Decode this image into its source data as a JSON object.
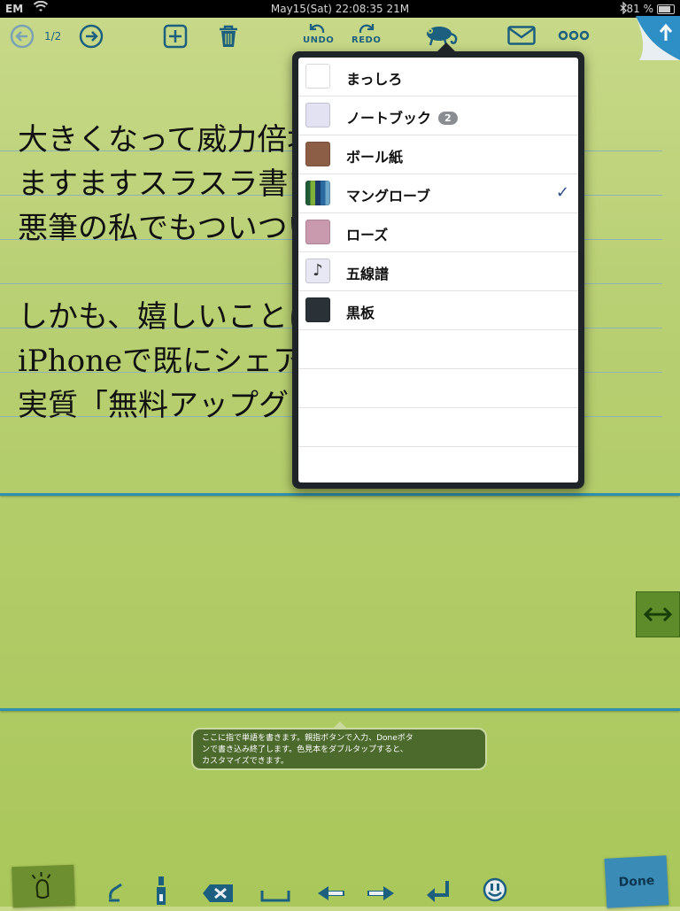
{
  "status_bar": {
    "carrier": "EM",
    "time": "May15(Sat) 22:08:35 21M",
    "battery": "81 %",
    "battery_level": 0.81
  },
  "toolbar": {
    "page_indicator": "1/2",
    "undo_label": "UNDO",
    "redo_label": "REDO",
    "icons": [
      "back-arrow-icon",
      "forward-arrow-icon",
      "plus-icon",
      "trash-icon",
      "undo-icon",
      "redo-icon",
      "chameleon-icon",
      "mail-icon",
      "more-icon",
      "share-icon"
    ]
  },
  "note_lines": [
    "大きくなって威力倍増!!",
    "ますますスラスラ書いて",
    "悪筆の私でもついつい",
    "",
    "しかも、嬉しいことに、",
    "iPhoneで既にシェアウ",
    "実質「無料アップグレー"
  ],
  "paper_menu": {
    "items": [
      {
        "label": "まっしろ",
        "color": "#ffffff",
        "badge": "",
        "checked": false
      },
      {
        "label": "ノートブック",
        "color": "#e2e2f2",
        "badge": "2",
        "checked": false
      },
      {
        "label": "ボール紙",
        "color": "#8b5e45",
        "badge": "",
        "checked": false
      },
      {
        "label": "マングローブ",
        "color": "#2a6aa0",
        "badge": "",
        "checked": true
      },
      {
        "label": "ローズ",
        "color": "#c99aae",
        "badge": "",
        "checked": false
      },
      {
        "label": "五線譜",
        "color": "#e8e8f4",
        "badge": "",
        "checked": false
      },
      {
        "label": "黒板",
        "color": "#2a3238",
        "badge": "",
        "checked": false
      }
    ],
    "empty_rows": 4,
    "check_mark": "✓",
    "staff_glyph": "♪"
  },
  "tooltip": {
    "text_line1": "ここに指で単語を書きます。親指ボタンで入力、Doneボタ",
    "text_line2": "ンで書き込み終了します。色見本をダブルタップすると、",
    "text_line3": "カスタマイズできます。"
  },
  "bottom_bar": {
    "done_label": "Done",
    "icons": [
      "thumb-icon",
      "eraser-icon",
      "pen-icon",
      "backspace-icon",
      "space-icon",
      "left-arrow-icon",
      "right-arrow-icon",
      "return-icon",
      "smiley-icon"
    ]
  },
  "colors": {
    "accent": "#1c5f7f",
    "paper": "#b8cf72",
    "guide_line": "#2e8fae"
  }
}
